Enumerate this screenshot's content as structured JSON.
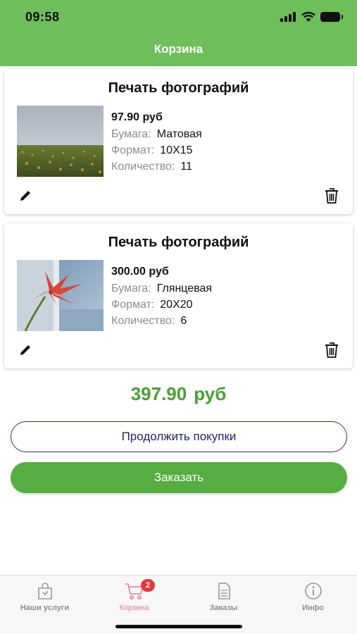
{
  "status_bar": {
    "time": "09:58"
  },
  "header": {
    "title": "Корзина"
  },
  "cart": {
    "items": [
      {
        "title": "Печать фотографий",
        "price": "97.90 руб",
        "paper_label": "Бумага:",
        "paper_value": "Матовая",
        "format_label": "Формат:",
        "format_value": "10X15",
        "qty_label": "Количество:",
        "qty_value": "11",
        "image": "sunflower-field-photo"
      },
      {
        "title": "Печать фотографий",
        "price": "300.00 руб",
        "paper_label": "Бумага:",
        "paper_value": "Глянцевая",
        "format_label": "Формат:",
        "format_value": "20X20",
        "qty_label": "Количество:",
        "qty_value": "6",
        "image": "red-flower-photo"
      }
    ],
    "edit_icon": "pencil-icon",
    "delete_icon": "trash-icon"
  },
  "total": {
    "amount": "397.90",
    "currency": "руб"
  },
  "buttons": {
    "continue": "Продолжить покупки",
    "order": "Заказать"
  },
  "tabbar": {
    "tabs": [
      {
        "label": "Наши услуги",
        "icon": "bag-icon"
      },
      {
        "label": "Корзина",
        "icon": "cart-icon",
        "badge": "2",
        "active": true
      },
      {
        "label": "Заказы",
        "icon": "document-icon"
      },
      {
        "label": "Инфо",
        "icon": "info-icon"
      }
    ]
  },
  "colors": {
    "header": "#6fbe5c",
    "accent": "#56ad42",
    "total": "#48a035",
    "active_tab": "#e6789a",
    "badge": "#e5393c",
    "outline_button": "#2d2d6e"
  }
}
